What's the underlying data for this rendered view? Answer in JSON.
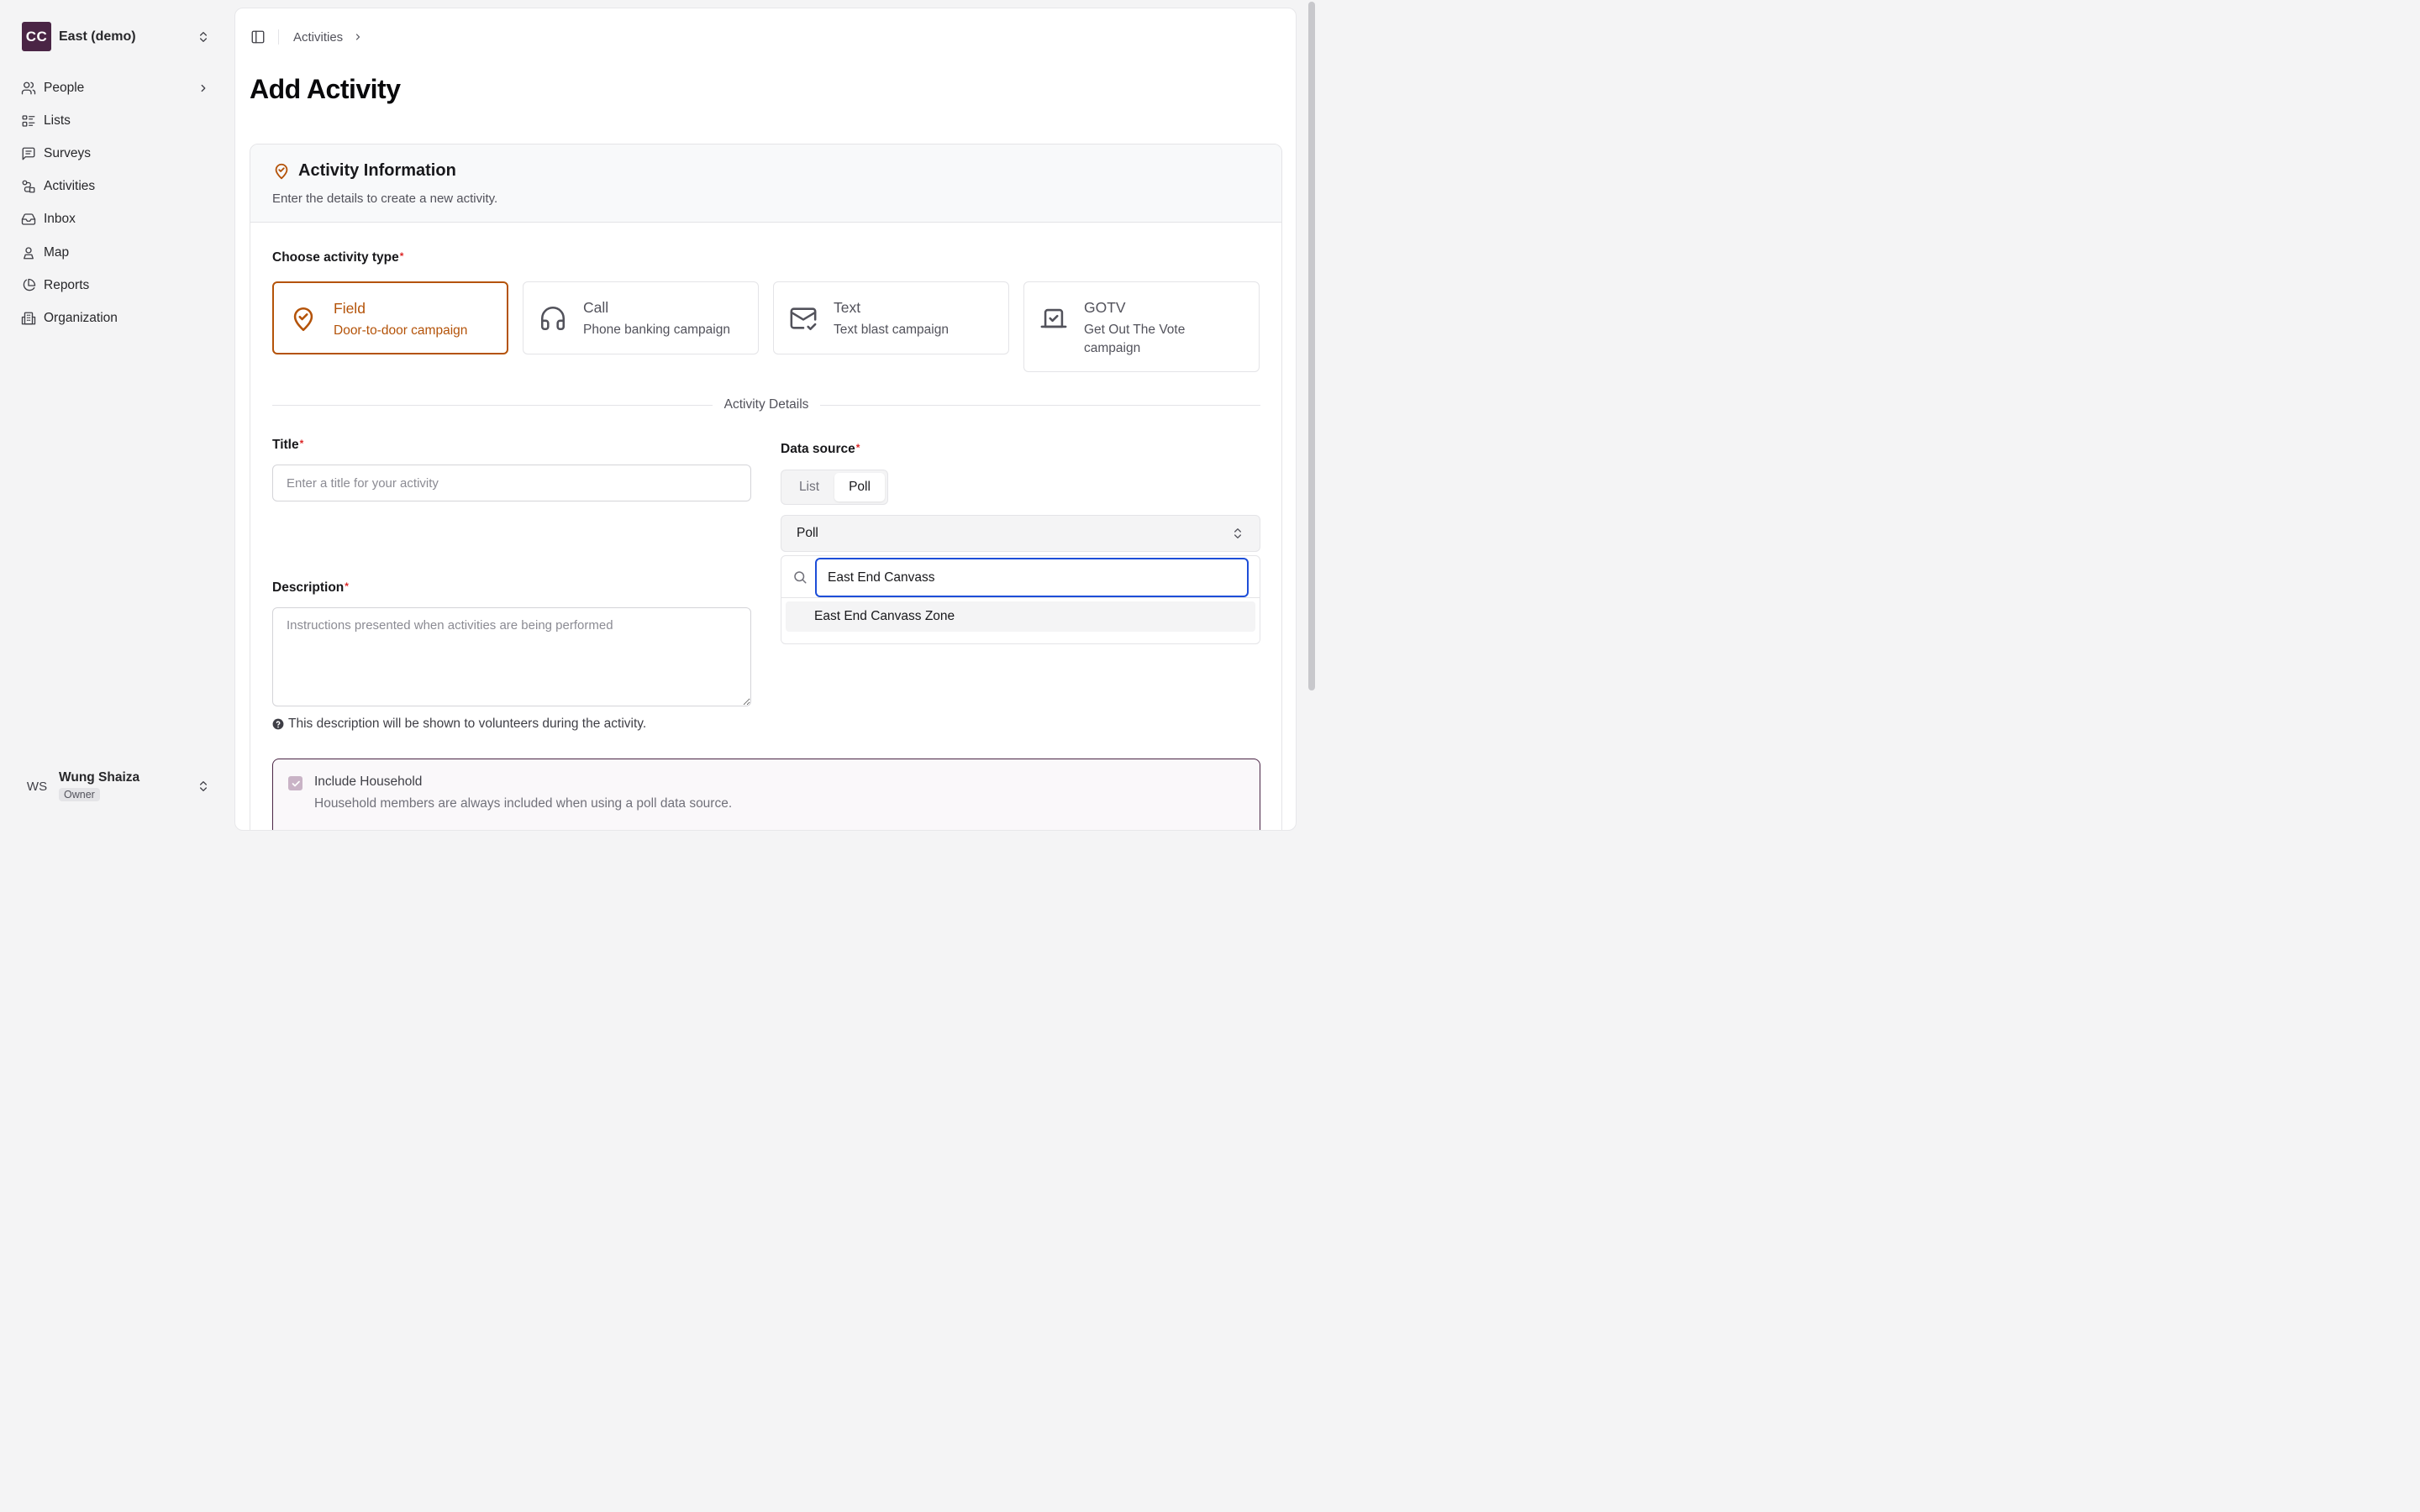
{
  "org": {
    "initials": "CC",
    "name": "East (demo)"
  },
  "nav": [
    {
      "label": "People",
      "icon": "users-icon"
    },
    {
      "label": "Lists",
      "icon": "list-icon"
    },
    {
      "label": "Surveys",
      "icon": "message-square-icon"
    },
    {
      "label": "Activities",
      "icon": "route-icon"
    },
    {
      "label": "Inbox",
      "icon": "inbox-icon"
    },
    {
      "label": "Map",
      "icon": "map-pin-user-icon"
    },
    {
      "label": "Reports",
      "icon": "pie-chart-icon"
    },
    {
      "label": "Organization",
      "icon": "building-icon"
    }
  ],
  "user": {
    "initials": "WS",
    "name": "Wung Shaiza",
    "role": "Owner"
  },
  "breadcrumb": {
    "item": "Activities"
  },
  "page": {
    "title": "Add Activity"
  },
  "card": {
    "title": "Activity Information",
    "subtitle": "Enter the details to create a new activity."
  },
  "activity_type": {
    "label": "Choose activity type",
    "required_mark": "*",
    "options": [
      {
        "name": "Field",
        "desc": "Door-to-door campaign",
        "icon": "map-pin-check-icon",
        "selected": true
      },
      {
        "name": "Call",
        "desc": "Phone banking campaign",
        "icon": "headphones-icon",
        "selected": false
      },
      {
        "name": "Text",
        "desc": "Text blast campaign",
        "icon": "mail-check-icon",
        "selected": false
      },
      {
        "name": "GOTV",
        "desc": "Get Out The Vote campaign",
        "icon": "vote-icon",
        "selected": false
      }
    ]
  },
  "section_divider": "Activity Details",
  "title_field": {
    "label": "Title",
    "required_mark": "*",
    "placeholder": "Enter a title for your activity",
    "value": ""
  },
  "description_field": {
    "label": "Description",
    "required_mark": "*",
    "placeholder": "Instructions presented when activities are being performed",
    "help": "This description will be shown to volunteers during the activity."
  },
  "data_source": {
    "label": "Data source",
    "required_mark": "*",
    "segments": [
      "List",
      "Poll"
    ],
    "active_segment": "Poll",
    "select_value": "Poll",
    "search_value": "East End Canvass",
    "options": [
      "East End Canvass Zone"
    ]
  },
  "household": {
    "title": "Include Household",
    "subtitle": "Household members are always included when using a poll data source.",
    "checked": true
  },
  "colors": {
    "accent": "#b45309",
    "brand": "#4a2545",
    "focus": "#1d4ed8",
    "required": "#dc2626"
  }
}
